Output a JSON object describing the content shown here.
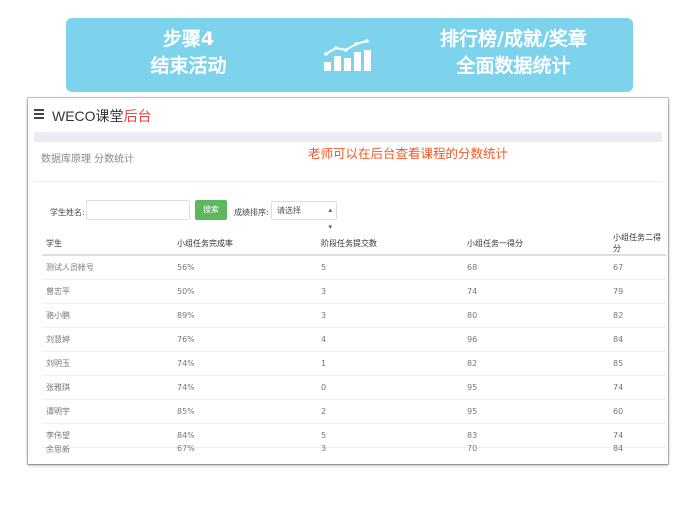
{
  "banner": {
    "step": "步骤4",
    "step_title": "结束活动",
    "feature": "排行榜/成就/奖章",
    "feature_sub": "全面数据统计",
    "icon": "bar-chart-trend-icon"
  },
  "app": {
    "brand": "WECO课堂",
    "brand_accent": "后台",
    "breadcrumb": "数据库原理 分数统计",
    "note": "老师可以在后台查看课程的分数统计"
  },
  "filters": {
    "name_label": "学生姓名:",
    "name_value": "",
    "search_label": "搜索",
    "sort_label": "成绩排序:",
    "sort_value": "请选择"
  },
  "table": {
    "headers": [
      "学生",
      "小组任务完成率",
      "阶段任务提交数",
      "小组任务一得分",
      "小组任务二得分"
    ],
    "rows": [
      [
        "测试人员帐号",
        "56%",
        "5",
        "68",
        "67"
      ],
      [
        "曾志平",
        "50%",
        "3",
        "74",
        "79"
      ],
      [
        "骆小鹏",
        "89%",
        "3",
        "80",
        "82"
      ],
      [
        "刘慧婷",
        "76%",
        "4",
        "96",
        "84"
      ],
      [
        "刘明玉",
        "74%",
        "1",
        "82",
        "85"
      ],
      [
        "张雅琪",
        "74%",
        "0",
        "95",
        "74"
      ],
      [
        "谭明宇",
        "85%",
        "2",
        "95",
        "60"
      ],
      [
        "李伟望",
        "84%",
        "5",
        "83",
        "74"
      ],
      [
        "余思新",
        "67%",
        "3",
        "70",
        "84"
      ]
    ]
  },
  "colors": {
    "banner_bg": "#7dd3ec",
    "brand_accent": "#e8453c",
    "note": "#f05a28",
    "search_button": "#5cb85c"
  }
}
